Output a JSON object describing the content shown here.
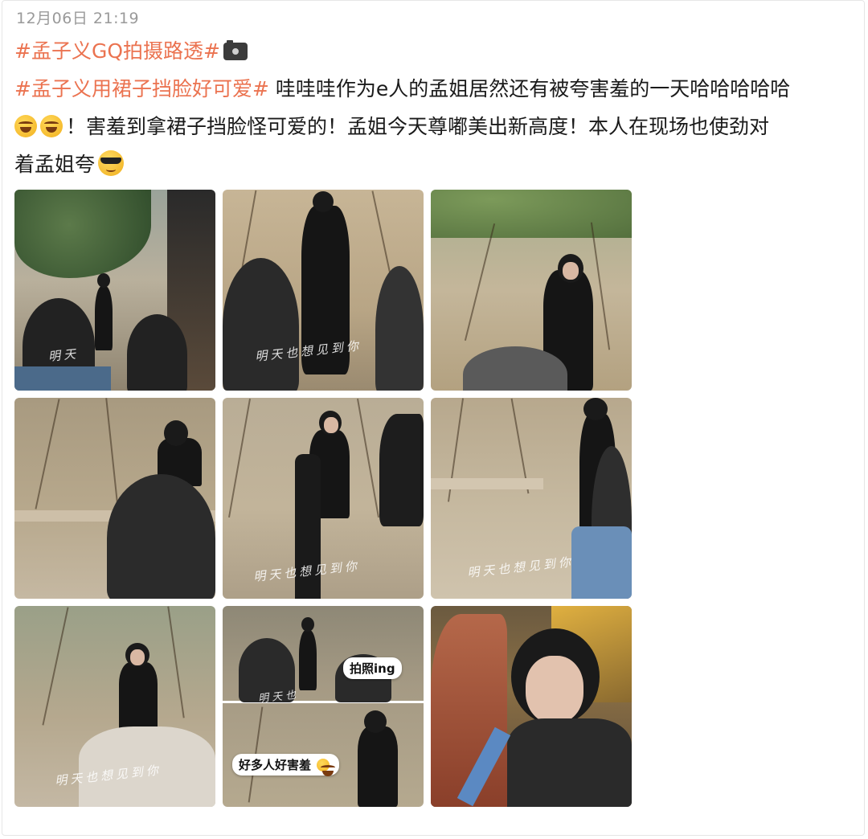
{
  "post": {
    "timestamp": "12月06日 21:19",
    "hashtag_1": "#孟子义GQ拍摄路透#",
    "hashtag_2": "#孟子义用裙子挡脸好可爱#",
    "body_line_1": " 哇哇哇作为e人的孟姐居然还有被夸害羞的一天哈哈哈哈哈",
    "body_line_2": "！害羞到拿裙子挡脸怪可爱的！孟姐今天尊嘟美出新高度！本人在现场也使劲对",
    "body_line_3": "着孟姐夸",
    "emoji_after_tag": "camera-icon",
    "emoji_line_2": [
      "laughing-crying-icon",
      "laughing-crying-icon"
    ],
    "emoji_line_3": "sunglasses-icon"
  },
  "gallery": {
    "photos": [
      {
        "watermark": "明天"
      },
      {
        "watermark": "明天也想见到你"
      },
      {
        "watermark": ""
      },
      {
        "watermark": ""
      },
      {
        "watermark": "明天也想见到你"
      },
      {
        "watermark": "明天也想见到你"
      },
      {
        "watermark": "明天也想见到你"
      },
      {
        "watermark": "明天也",
        "sticker_top": "拍照ing",
        "sticker_bottom": "好多人好害羞"
      },
      {
        "watermark": ""
      }
    ]
  },
  "colors": {
    "hashtag": "#eb7350",
    "timestamp": "#9a9a9a",
    "text": "#1a1a1a"
  }
}
